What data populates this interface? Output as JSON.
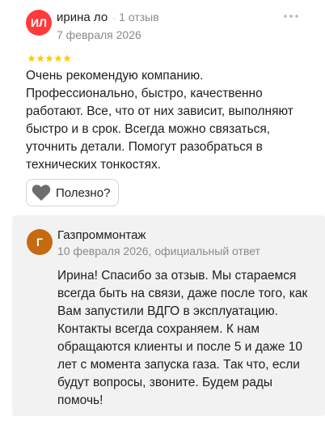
{
  "review": {
    "avatar_initials": "ИЛ",
    "avatar_color": "#ff3b3b",
    "author": "ирина ло",
    "separator": "·",
    "review_count": "1 отзыв",
    "date": "7 февраля 2026",
    "rating": 5,
    "rating_max": 5,
    "star_color": "#fc0",
    "text": "Очень рекомендую компанию. Профессионально, быстро, качественно работают. Все, что от них зависит, выполняют быстро и в срок. Всегда можно связаться, уточнить детали. Помогут разобраться в технических тонкостях.",
    "more_icon": "more-dots-icon",
    "helpful_label": "Полезно?",
    "helpful_icon": "heart-icon"
  },
  "reply": {
    "avatar_initials": "Г",
    "avatar_color": "#c66a12",
    "author": "Газпроммонтаж",
    "meta": "10 февраля 2026, официальный ответ",
    "text": "Ирина! Спасибо за отзыв. Мы стараемся всегда быть на связи, даже после того, как Вам запустили ВДГО в эксплуатацию. Контакты всегда сохраняем. К нам обращаются клиенты и после 5 и даже 10 лет с момента запуска газа. Так что, если будут вопросы, звоните. Будем рады помочь!"
  }
}
